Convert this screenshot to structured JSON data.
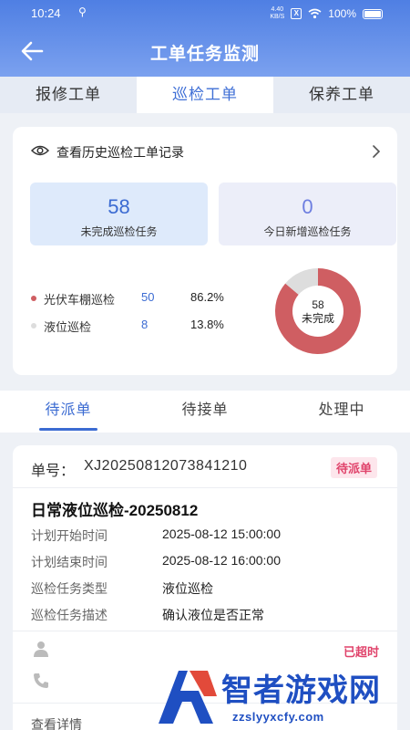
{
  "status_bar": {
    "time": "10:24",
    "speed": "4.40\nKB/S",
    "battery": "100%"
  },
  "header": {
    "title": "工单任务监测"
  },
  "top_tabs": [
    {
      "label": "报修工单",
      "active": false
    },
    {
      "label": "巡检工单",
      "active": true
    },
    {
      "label": "保养工单",
      "active": false
    }
  ],
  "stats": {
    "history_label": "查看历史巡检工单记录",
    "unfinished": {
      "value": "58",
      "label": "未完成巡检任务"
    },
    "new_today": {
      "value": "0",
      "label": "今日新增巡检任务"
    },
    "legend": [
      {
        "name": "光伏车棚巡检",
        "count": "50",
        "percent": "86.2%",
        "color": "#cf5e62"
      },
      {
        "name": "液位巡检",
        "count": "8",
        "percent": "13.8%",
        "color": "#dddddd"
      }
    ],
    "donut_center": {
      "value": "58",
      "label": "未完成"
    }
  },
  "status_tabs": [
    {
      "label": "待派单",
      "active": true
    },
    {
      "label": "待接单",
      "active": false
    },
    {
      "label": "处理中",
      "active": false
    }
  ],
  "order": {
    "number_label": "单号：",
    "number": "XJ20250812073841210",
    "status": "待派单",
    "title": "日常液位巡检-20250812",
    "fields": [
      {
        "label": "计划开始时间",
        "value": "2025-08-12 15:00:00"
      },
      {
        "label": "计划结束时间",
        "value": "2025-08-12 16:00:00"
      },
      {
        "label": "巡检任务类型",
        "value": "液位巡检"
      },
      {
        "label": "巡检任务描述",
        "value": "确认液位是否正常"
      }
    ],
    "overtime": "已超时",
    "detail_link": "查看详情"
  },
  "watermark": {
    "title": "智者游戏网",
    "url": "zzslyyxcfy.com"
  },
  "colors": {
    "primary": "#3b6bd2",
    "alert": "#e0436b",
    "donut_main": "#cf5e62",
    "donut_rest": "#dddddd"
  }
}
